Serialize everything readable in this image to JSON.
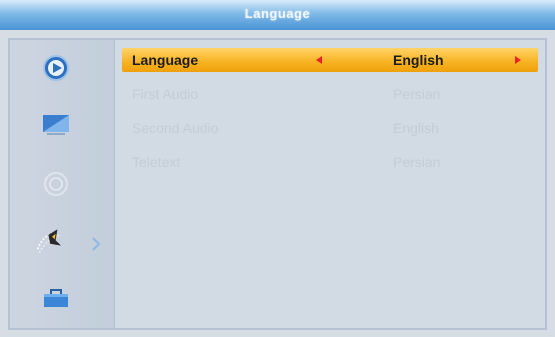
{
  "window": {
    "title": "Language"
  },
  "sidebar": {
    "items": [
      {
        "icon": "play-disc-icon",
        "active": false
      },
      {
        "icon": "tv-screen-icon",
        "active": false
      },
      {
        "icon": "globe-icon",
        "active": false
      },
      {
        "icon": "satellite-dish-icon",
        "active": true
      },
      {
        "icon": "toolbox-icon",
        "active": false
      }
    ],
    "active_indicator": "chevron-right-icon"
  },
  "menu": {
    "rows": [
      {
        "label": "Language",
        "value": "English",
        "selected": true
      },
      {
        "label": "First Audio",
        "value": "Persian",
        "selected": false
      },
      {
        "label": "Second Audio",
        "value": "English",
        "selected": false
      },
      {
        "label": "Teletext",
        "value": "Persian",
        "selected": false
      }
    ]
  },
  "colors": {
    "titlebar": "#4a93d6",
    "highlight": "#f7b21f",
    "arrow": "#e8222a",
    "disabled_text": "#c4ccd6"
  }
}
